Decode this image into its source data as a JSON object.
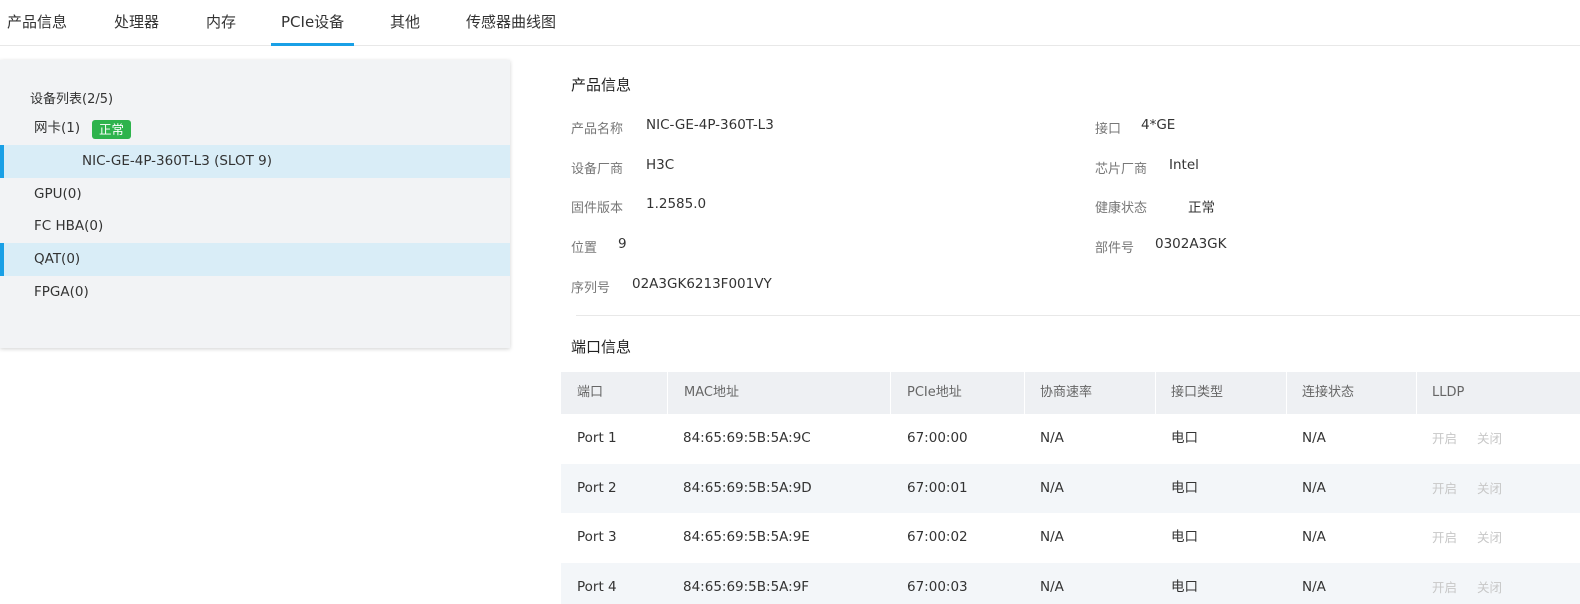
{
  "tabs": [
    {
      "label": "产品信息"
    },
    {
      "label": "处理器"
    },
    {
      "label": "内存"
    },
    {
      "label": "PCIe设备",
      "active": true
    },
    {
      "label": "其他"
    },
    {
      "label": "传感器曲线图"
    }
  ],
  "device_list": {
    "title": "设备列表(2/5)",
    "items": [
      {
        "label": "网卡(1)",
        "badge": "正常"
      },
      {
        "label": "NIC-GE-4P-360T-L3 (SLOT 9)",
        "selected": true
      },
      {
        "label": "GPU(0)"
      },
      {
        "label": "FC HBA(0)"
      },
      {
        "label": "QAT(0)",
        "selected": true
      },
      {
        "label": "FPGA(0)"
      }
    ]
  },
  "product_info": {
    "title": "产品信息",
    "fields": {
      "name": {
        "label": "产品名称",
        "value": "NIC-GE-4P-360T-L3"
      },
      "interface": {
        "label": "接口",
        "value": "4*GE"
      },
      "vendor": {
        "label": "设备厂商",
        "value": "H3C"
      },
      "chip_vendor": {
        "label": "芯片厂商",
        "value": "Intel"
      },
      "firmware": {
        "label": "固件版本",
        "value": "1.2585.0"
      },
      "health": {
        "label": "健康状态",
        "value": "正常"
      },
      "location": {
        "label": "位置",
        "value": "9"
      },
      "part_number": {
        "label": "部件号",
        "value": "0302A3GK"
      },
      "serial": {
        "label": "序列号",
        "value": "02A3GK6213F001VY"
      }
    }
  },
  "port_info": {
    "title": "端口信息",
    "columns": [
      "端口",
      "MAC地址",
      "PCIe地址",
      "协商速率",
      "接口类型",
      "连接状态",
      "LLDP"
    ],
    "rows": [
      {
        "port": "Port 1",
        "mac": "84:65:69:5B:5A:9C",
        "pcie": "67:00:00",
        "speed": "N/A",
        "type": "电口",
        "link": "N/A",
        "on": "开启",
        "off": "关闭"
      },
      {
        "port": "Port 2",
        "mac": "84:65:69:5B:5A:9D",
        "pcie": "67:00:01",
        "speed": "N/A",
        "type": "电口",
        "link": "N/A",
        "on": "开启",
        "off": "关闭"
      },
      {
        "port": "Port 3",
        "mac": "84:65:69:5B:5A:9E",
        "pcie": "67:00:02",
        "speed": "N/A",
        "type": "电口",
        "link": "N/A",
        "on": "开启",
        "off": "关闭"
      },
      {
        "port": "Port 4",
        "mac": "84:65:69:5B:5A:9F",
        "pcie": "67:00:03",
        "speed": "N/A",
        "type": "电口",
        "link": "N/A",
        "on": "开启",
        "off": "关闭"
      }
    ]
  },
  "colors": {
    "accent": "#19a0e6",
    "status_ok": "#2eb34c",
    "selected_row": "#d9edf7"
  }
}
